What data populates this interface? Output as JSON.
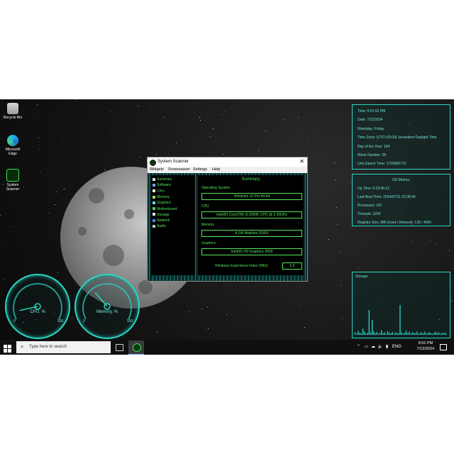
{
  "desktop": {
    "icons": [
      {
        "label": "Recycle Bin",
        "icon": "recycle-bin-icon"
      },
      {
        "label": "Microsoft Edge",
        "icon": "edge-icon"
      },
      {
        "label": "System Scanner",
        "icon": "system-scanner-icon"
      }
    ]
  },
  "gauges": [
    {
      "label": "CPU, %",
      "min": "0",
      "max": "100",
      "value_fraction": 0.12
    },
    {
      "label": "Memory, %",
      "min": "0",
      "max": "100",
      "value_fraction": 0.35
    }
  ],
  "time_panel": {
    "rows": [
      "Time: 8:51:52 PM",
      "Date: 7/12/2024",
      "Weekday: Friday",
      "Time Zone: (UTC+03:00) Jerusalem Daylight Time",
      "Day of the Year: 194",
      "Week Number: 28",
      "Unix Epoch Time: 1720806712"
    ]
  },
  "os_panel": {
    "title": "OS Metrics",
    "rows": [
      "Up Time: 0:23:45:12",
      "Last Boot Time: 2024/07/11 20:38:40",
      "Processes: 115",
      "Threads: 1209",
      "Registry Size, MB (Used / Allowed): 139 / 4005"
    ]
  },
  "storage_panel": {
    "title": "Storage",
    "bars": [
      0.05,
      0.02,
      0.08,
      0.04,
      0.03,
      0.12,
      0.06,
      0.02,
      0.04,
      0.5,
      0.05,
      0.3,
      0.07,
      0.03,
      0.06,
      0.02,
      0.04,
      0.09,
      0.03,
      0.05,
      0.02,
      0.07,
      0.04,
      0.03,
      0.06,
      0.02,
      0.05,
      0.04,
      0.03,
      0.6,
      0.05,
      0.02,
      0.04,
      0.08,
      0.03,
      0.06,
      0.02,
      0.05,
      0.04,
      0.03,
      0.07,
      0.02,
      0.04,
      0.05,
      0.03,
      0.06,
      0.02,
      0.04,
      0.05,
      0.03,
      0.02,
      0.04,
      0.06,
      0.03,
      0.05,
      0.02,
      0.04,
      0.03,
      0.05,
      0.02
    ]
  },
  "window": {
    "title": "System Scanner",
    "menu": [
      "Widgets",
      "Screensaver",
      "Settings",
      "Help"
    ],
    "nav": [
      {
        "label": "Summary",
        "color": "#e0e0e0"
      },
      {
        "label": "Software",
        "color": "#6aa7ff"
      },
      {
        "label": "CPU",
        "color": "#ffffff"
      },
      {
        "label": "Memory",
        "color": "#9be06a"
      },
      {
        "label": "Graphics",
        "color": "#6ad6e0"
      },
      {
        "label": "Motherboard",
        "color": "#5ac85a"
      },
      {
        "label": "Storage",
        "color": "#e0e0e0"
      },
      {
        "label": "Network",
        "color": "#4a8ae0"
      },
      {
        "label": "Audio",
        "color": "#c0c0c0"
      }
    ],
    "content": {
      "title": "Summary",
      "os_label": "Operating System",
      "os_value": "Windows 10 Pro 64-bit",
      "cpu_label": "CPU",
      "cpu_value": "Intel(R) Core(TM) i5-2500K CPU @ 3.30GHz",
      "memory_label": "Memory",
      "memory_value": "8 GB Modules DDR3",
      "graphics_label": "Graphics",
      "graphics_value": "Intel(R) HD Graphics 3000",
      "wei_label": "Windows Experience Index (WEI)",
      "wei_value": "5.9"
    }
  },
  "taskbar": {
    "search_placeholder": "Type here to search",
    "tray": {
      "lang": "ENG",
      "time": "8:51 PM",
      "date": "7/12/2024"
    }
  },
  "colors": {
    "accent": "#2ad6c4",
    "terminal_green": "#54e85c"
  }
}
